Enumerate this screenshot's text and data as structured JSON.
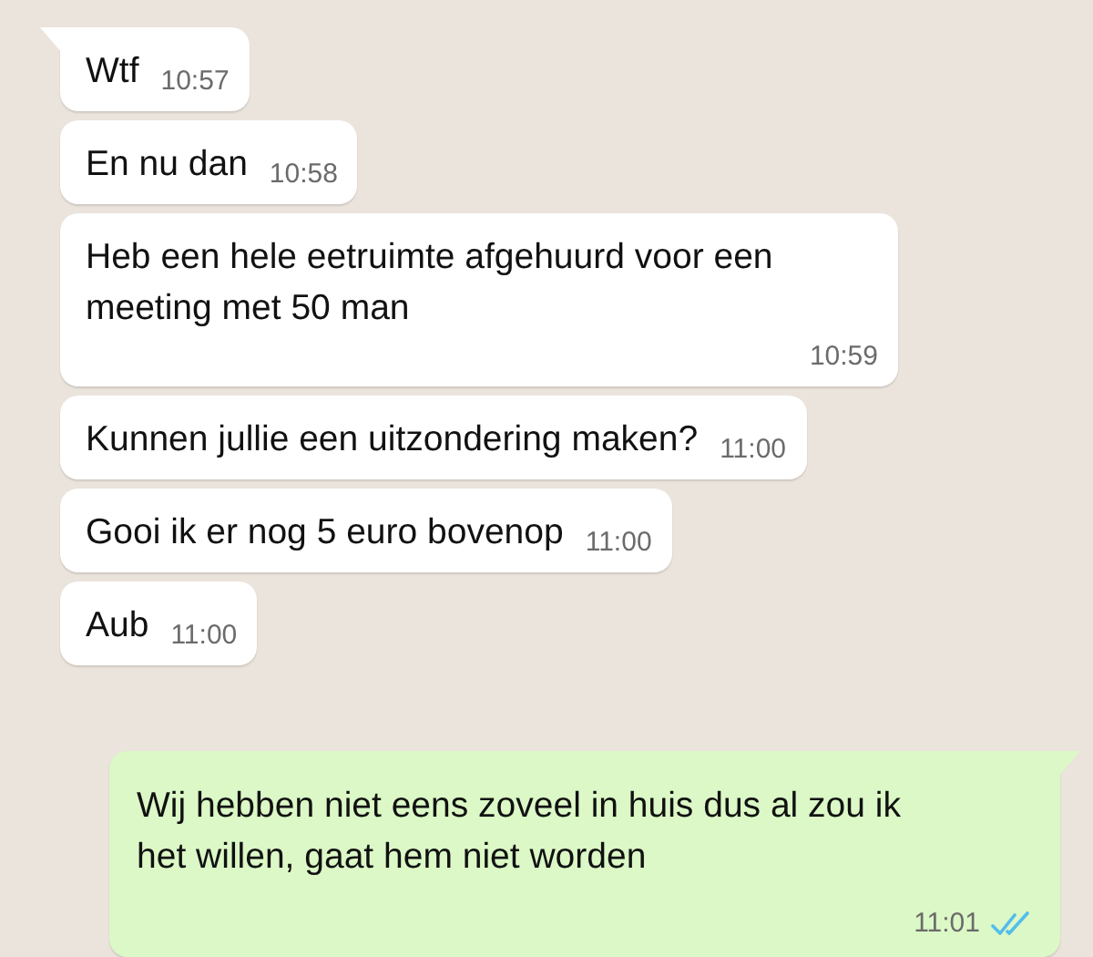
{
  "messages": [
    {
      "kind": "incoming",
      "tail": true,
      "text": "Wtf",
      "time": "10:57"
    },
    {
      "kind": "incoming",
      "tail": false,
      "text": "En nu dan",
      "time": "10:58"
    },
    {
      "kind": "incoming",
      "tail": false,
      "text": "Heb een hele eetruimte afgehuurd voor een meeting met 50 man",
      "time": "10:59"
    },
    {
      "kind": "incoming",
      "tail": false,
      "text": "Kunnen jullie een uitzondering maken?",
      "time": "11:00"
    },
    {
      "kind": "incoming",
      "tail": false,
      "text": "Gooi ik er nog 5 euro bovenop",
      "time": "11:00"
    },
    {
      "kind": "incoming",
      "tail": false,
      "text": "Aub",
      "time": "11:00"
    },
    {
      "kind": "outgoing",
      "tail": true,
      "text": "Wij hebben niet eens zoveel in huis dus al zou ik het willen, gaat hem niet worden",
      "time": "11:01",
      "read": true
    }
  ]
}
